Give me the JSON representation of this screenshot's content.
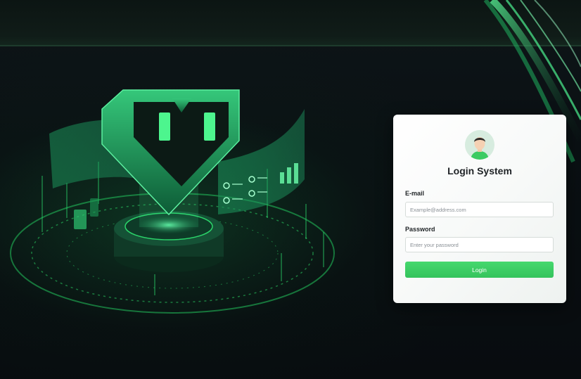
{
  "login": {
    "title": "Login System",
    "email": {
      "label": "E-mail",
      "placeholder": "Example@address.com",
      "value": ""
    },
    "password": {
      "label": "Password",
      "placeholder": "Enter your password",
      "value": ""
    },
    "submit_label": "Login"
  },
  "theme": {
    "accent": "#3ccb62",
    "background": "#0b1014",
    "card": "#ffffff",
    "glow": "#2be07a"
  },
  "icons": [
    "user-avatar-icon",
    "shield-icon"
  ]
}
